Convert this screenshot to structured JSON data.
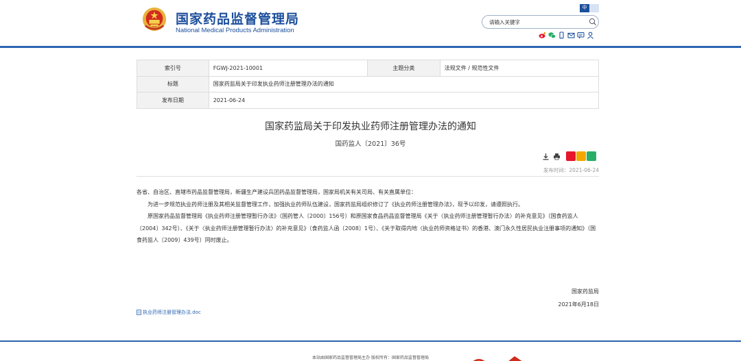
{
  "header": {
    "site_name_cn": "国家药品监督管理局",
    "site_name_en": "National Medical Products Administration",
    "lang_active": "中",
    "lang_inactive": "",
    "search_placeholder": "请输入关键字",
    "colors": {
      "brand_blue": "#1c4f9c",
      "rule_blue": "#2b63b0"
    },
    "social_icons": [
      "weibo-icon",
      "wechat-icon",
      "mobile-icon",
      "mail-icon",
      "message-icon",
      "user-icon"
    ]
  },
  "meta": {
    "index_label": "索引号",
    "index_value": "FGWJ-2021-10001",
    "category_label": "主题分类",
    "category_value": "法规文件 / 规范性文件",
    "title_label": "标题",
    "title_value": "国家药监局关于印发执业药师注册管理办法的通知",
    "date_label": "发布日期",
    "date_value": "2021-06-24"
  },
  "article": {
    "title": "国家药监局关于印发执业药师注册管理办法的通知",
    "doc_number": "国药监人〔2021〕36号",
    "publish_time": "发布时间：2021-06-24",
    "addressee": "各省、自治区、直辖市药品监督管理局，新疆生产建设兵团药品监督管理局，国家局机关有关司局、有关直属单位：",
    "para1": "为进一步规范执业药师注册及其相关监督管理工作，加强执业药师队伍建设，国家药监局组织修订了《执业药师注册管理办法》，现予以印发，请遵照执行。",
    "para2": "原国家药品监督管理局《执业药师注册管理暂行办法》（国药管人〔2000〕156号）和原国家食品药品监督管理局《关于〈执业药师注册管理暂行办法〉的补充意见》（国食药监人〔2004〕342号）、《关于〈执业药师注册管理暂行办法〉的补充意见》（食药监人函〔2008〕1号）、《关于取得内地〈执业药师资格证书〉的香港、澳门永久性居民执业注册事项的通知》（国食药监人〔2009〕439号）同时废止。",
    "sign_org": "国家药监局",
    "sign_date": "2021年6月18日",
    "attachment": "执业药师注册管理办法.doc",
    "tool_icons": [
      "download-icon",
      "print-icon",
      "weibo-share-icon",
      "qzone-share-icon",
      "wechat-share-icon"
    ]
  },
  "footer": {
    "text": "本站由国家药品监督管理局主办 版权所有：国家药品监督管理局"
  }
}
